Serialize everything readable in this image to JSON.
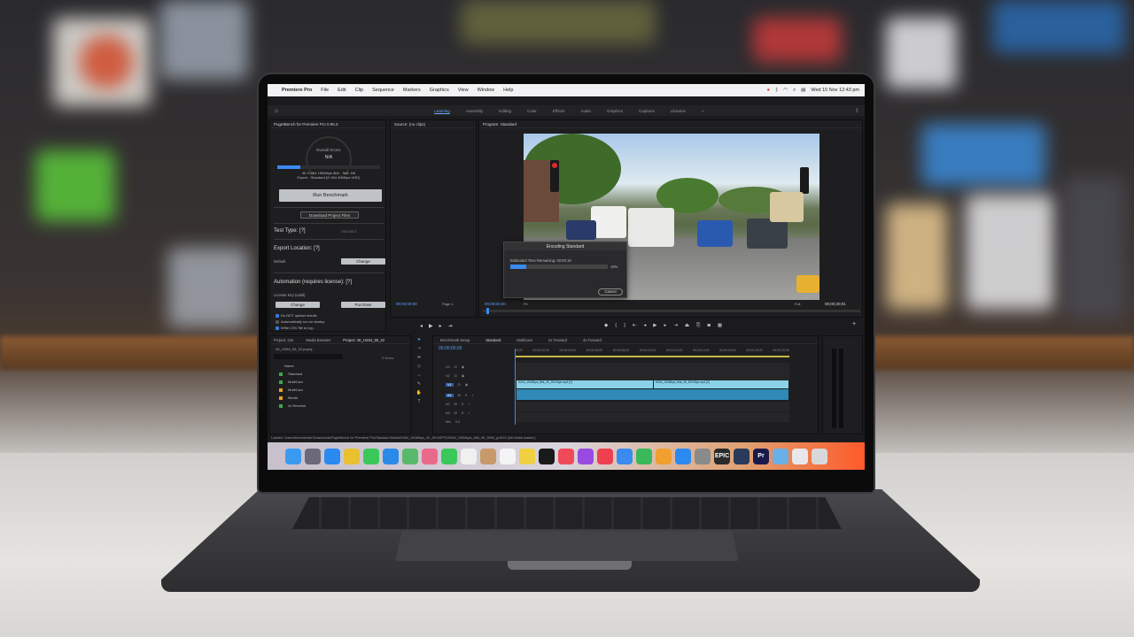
{
  "menubar": {
    "app": "Premiere Pro",
    "items": [
      "File",
      "Edit",
      "Clip",
      "Sequence",
      "Markers",
      "Graphics",
      "View",
      "Window",
      "Help"
    ],
    "clock": "Wed 10 Nov  12:43 pm"
  },
  "workspace": {
    "tabs": [
      "Learning",
      "Assembly",
      "Editing",
      "Color",
      "Effects",
      "Audio",
      "Graphics",
      "Captions",
      "Libraries"
    ],
    "active": "Learning",
    "more": "»"
  },
  "benchmark": {
    "title": "PugetBench for Premiere Pro 0.95.3",
    "score_label": "Overall Score:",
    "score_value": "N/A",
    "progress": 0.22,
    "test_line1": "4K H.264 150Mbps 8bit - Test: 5/8",
    "test_line2": "Export - Standard (H.264 40Mbps UHD)",
    "run_button": "Run Benchmark",
    "download_button": "Download Project Files",
    "test_type_heading": "Test Type:   [?]",
    "test_type_value": "Standard",
    "export_heading": "Export Location:   [?]",
    "export_value": "Default",
    "change_label": "Change",
    "automation_heading": "Automation (requires license):   [?]",
    "license_text": "License Key (valid)",
    "purchase_label": "Purchase",
    "checkbox1": "Do NOT upload results",
    "checkbox2": "Automatically run on startup",
    "checkbox3": "Write CSV file to log..."
  },
  "source": {
    "title": "Source: (no clips)",
    "timecode": "00;00;00;00",
    "page": "Page 1"
  },
  "program": {
    "title": "Program: Standard",
    "timecode_left": "00;00;00;00",
    "fit": "Fit",
    "full": "Full",
    "timecode_right": "00;00;20;01"
  },
  "dialog": {
    "title": "Encoding Standard",
    "eta": "Estimated Time Remaining: 00:00:19",
    "percent": "16%",
    "progress": 0.16,
    "cancel": "Cancel"
  },
  "project": {
    "tabs": [
      "Project: 22e",
      "Media Browser",
      "Project: 4K_H264_59_22"
    ],
    "file": "4K_H264_59_22.prproj",
    "items": "9 Items",
    "name_header": "Name",
    "rows": [
      {
        "name": "Standard",
        "color": "#3aa84a"
      },
      {
        "name": "MultiCam",
        "color": "#3aa84a"
      },
      {
        "name": "MultiCam",
        "color": "#e8a030"
      },
      {
        "name": "Media",
        "color": "#e8a030"
      },
      {
        "name": "4x Reverse",
        "color": "#3aa84a"
      }
    ]
  },
  "timeline": {
    "tabs": [
      "Benchmark Setup",
      "Standard",
      "MultiCam",
      "2x Forward",
      "4x Forward"
    ],
    "active": "Standard",
    "timecode": "00;00;00;00",
    "ruler": [
      "00;00",
      "00;00;02;00",
      "00;00;04;00",
      "00;00;06;00",
      "00;00;08;00",
      "00;00;10;00",
      "00;00;12;00",
      "00;00;14;00",
      "00;00;16;00",
      "00;00;18;00",
      "00;00;20;00"
    ],
    "tracks": [
      "V3",
      "V2",
      "V1",
      "A1",
      "A2",
      "A3"
    ],
    "clip1": "H264_150Mbps_8bit_4K_59.94fps.mp4 [V]",
    "clip2": "H264_150Mbps_8bit_4K_59.94fps.mp4 [V]",
    "master": "Mix",
    "master_value": "0.0"
  },
  "status": "Loaded: /Users/benchtester/Downloads/PugetBench for Premiere Pro/Standard Media/H264_150Mbps_4K_59.94FPS/H264_150Mbps_8bit_4K_5994_g.MOV (All media loaded.)",
  "dock": [
    {
      "icon": "finder-icon",
      "color": "#3a9af0"
    },
    {
      "icon": "launchpad-icon",
      "color": "#6a6a7a"
    },
    {
      "icon": "safari-icon",
      "color": "#2a8af0"
    },
    {
      "icon": "chrome-icon",
      "color": "#e8c030"
    },
    {
      "icon": "messages-icon",
      "color": "#3ac85a"
    },
    {
      "icon": "mail-icon",
      "color": "#2a8ae8"
    },
    {
      "icon": "maps-icon",
      "color": "#5ab86a"
    },
    {
      "icon": "photos-icon",
      "color": "#e86a8a"
    },
    {
      "icon": "facetime-icon",
      "color": "#3ac85a"
    },
    {
      "icon": "calendar-icon",
      "color": "#f0f0f0"
    },
    {
      "icon": "contacts-icon",
      "color": "#c89a6a"
    },
    {
      "icon": "reminders-icon",
      "color": "#f4f4f4"
    },
    {
      "icon": "notes-icon",
      "color": "#f0d040"
    },
    {
      "icon": "tv-icon",
      "color": "#1a1a1a"
    },
    {
      "icon": "music-icon",
      "color": "#f04a5a"
    },
    {
      "icon": "podcasts-icon",
      "color": "#9a4ae0"
    },
    {
      "icon": "news-icon",
      "color": "#f04050"
    },
    {
      "icon": "keynote-icon",
      "color": "#3a8af0"
    },
    {
      "icon": "numbers-icon",
      "color": "#3ab85a"
    },
    {
      "icon": "pages-icon",
      "color": "#f0a030"
    },
    {
      "icon": "appstore-icon",
      "color": "#2a8af0"
    },
    {
      "icon": "settings-icon",
      "color": "#8a8a8a"
    },
    {
      "icon": "epic-games-icon",
      "color": "#2a2a2a",
      "label": "EPIC"
    },
    {
      "icon": "davinci-icon",
      "color": "#2a3a5a"
    },
    {
      "icon": "premiere-icon",
      "color": "#1a1a4a",
      "label": "Pr"
    },
    {
      "icon": "folder-icon",
      "color": "#6ab0e8"
    },
    {
      "icon": "finder-window-icon",
      "color": "#e8e8ec"
    },
    {
      "icon": "trash-icon",
      "color": "#d8d8dc"
    }
  ]
}
